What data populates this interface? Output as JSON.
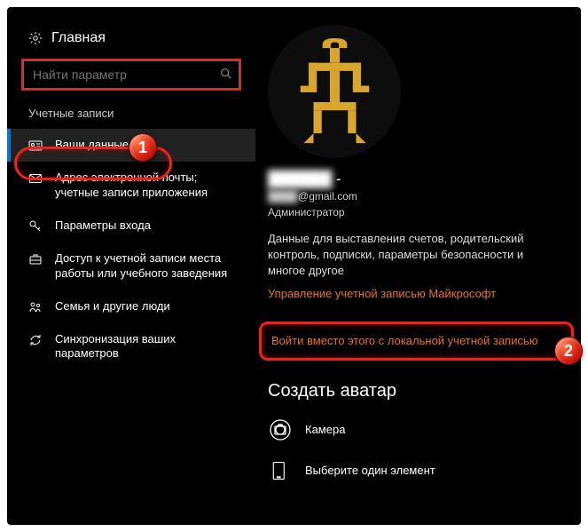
{
  "home": {
    "label": "Главная"
  },
  "search": {
    "placeholder": "Найти параметр"
  },
  "section": {
    "label": "Учетные записи"
  },
  "nav": [
    {
      "label": "Ваши данные"
    },
    {
      "label": "Адрес электронной почты; учетные записи приложения"
    },
    {
      "label": "Параметры входа"
    },
    {
      "label": "Доступ к учетной записи места работы или учебного заведения"
    },
    {
      "label": "Семья и другие люди"
    },
    {
      "label": "Синхронизация ваших параметров"
    }
  ],
  "account": {
    "name_hidden": "██████",
    "name_suffix": " -",
    "email_hidden": "████",
    "email_domain": "@gmail.com",
    "role": "Администратор",
    "desc": "Данные для выставления счетов, родительский контроль, подписки, параметры безопасности и многое другое",
    "manage_link": "Управление учетной записью Майкрософт",
    "local_link": "Войти вместо этого с локальной учетной записью"
  },
  "avatar_section": {
    "title": "Создать аватар",
    "camera": "Камера",
    "choose": "Выберите один элемент"
  },
  "badges": {
    "one": "1",
    "two": "2"
  }
}
